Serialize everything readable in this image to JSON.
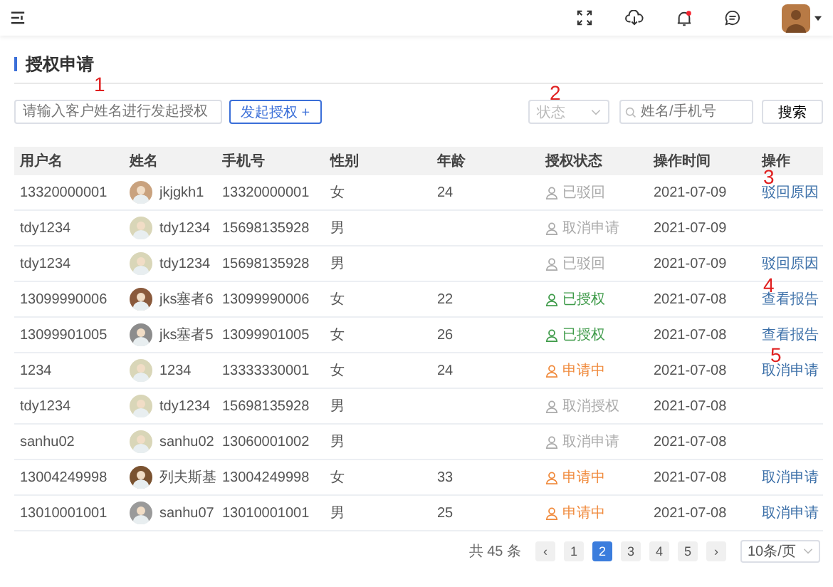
{
  "page": {
    "title": "授权申请"
  },
  "filters": {
    "customer_field": {
      "placeholder": "请输入客户姓名进行发起授权"
    },
    "start_button": "发起授权 +",
    "status_select": {
      "placeholder": "状态"
    },
    "search_field": {
      "placeholder": "姓名/手机号"
    },
    "search_button": "搜索"
  },
  "table": {
    "columns": [
      "用户名",
      "姓名",
      "手机号",
      "性别",
      "年龄",
      "授权状态",
      "操作时间",
      "操作"
    ],
    "rows": [
      {
        "username": "13320000001",
        "name": "jkjgkh1",
        "phone": "13320000001",
        "gender": "女",
        "age": "24",
        "status": {
          "text": "已驳回",
          "kind": "inactive"
        },
        "time": "2021-07-09",
        "action": "驳回原因"
      },
      {
        "username": "tdy1234",
        "name": "tdy1234",
        "phone": "15698135928",
        "gender": "男",
        "status": {
          "text": "取消申请",
          "kind": "inactive"
        },
        "time": "2021-07-09"
      },
      {
        "username": "tdy1234",
        "name": "tdy1234",
        "phone": "15698135928",
        "gender": "男",
        "status": {
          "text": "已驳回",
          "kind": "inactive"
        },
        "time": "2021-07-09",
        "action": "驳回原因"
      },
      {
        "username": "13099990006",
        "name": "jks塞者6",
        "phone": "13099990006",
        "gender": "女",
        "age": "22",
        "status": {
          "text": "已授权",
          "kind": "granted"
        },
        "time": "2021-07-08",
        "action": "查看报告"
      },
      {
        "username": "13099901005",
        "name": "jks塞者5",
        "phone": "13099901005",
        "gender": "女",
        "age": "26",
        "status": {
          "text": "已授权",
          "kind": "granted"
        },
        "time": "2021-07-08",
        "action": "查看报告"
      },
      {
        "username": "1234",
        "name": "1234",
        "phone": "13333330001",
        "gender": "女",
        "age": "24",
        "status": {
          "text": "申请中",
          "kind": "pending"
        },
        "time": "2021-07-08",
        "action": "取消申请"
      },
      {
        "username": "tdy1234",
        "name": "tdy1234",
        "phone": "15698135928",
        "gender": "男",
        "status": {
          "text": "取消授权",
          "kind": "inactive"
        },
        "time": "2021-07-08"
      },
      {
        "username": "sanhu02",
        "name": "sanhu02",
        "phone": "13060001002",
        "gender": "男",
        "status": {
          "text": "取消申请",
          "kind": "inactive"
        },
        "time": "2021-07-08"
      },
      {
        "username": "13004249998",
        "name": "列夫斯基",
        "phone": "13004249998",
        "gender": "女",
        "age": "33",
        "status": {
          "text": "申请中",
          "kind": "pending"
        },
        "time": "2021-07-08",
        "action": "取消申请"
      },
      {
        "username": "13010001001",
        "name": "sanhu07",
        "phone": "13010001001",
        "gender": "男",
        "age": "25",
        "status": {
          "text": "申请中",
          "kind": "pending"
        },
        "time": "2021-07-08",
        "action": "取消申请"
      }
    ]
  },
  "pagination": {
    "total": "共 45 条",
    "prev": "‹",
    "next": "›",
    "pages": [
      {
        "label": "1",
        "selected": false
      },
      {
        "label": "2",
        "selected": true
      },
      {
        "label": "3",
        "selected": false
      },
      {
        "label": "4",
        "selected": false
      },
      {
        "label": "5",
        "selected": false
      }
    ],
    "page_size": "10条/页"
  },
  "annotations": [
    "1",
    "2",
    "3",
    "4",
    "5"
  ]
}
